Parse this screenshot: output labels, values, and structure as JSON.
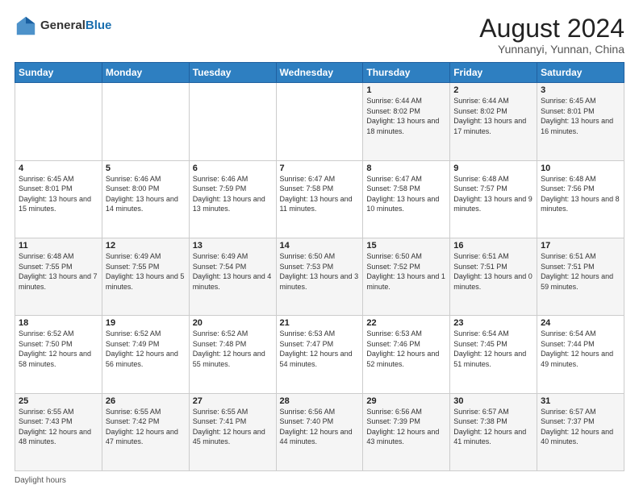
{
  "header": {
    "logo_general": "General",
    "logo_blue": "Blue",
    "main_title": "August 2024",
    "subtitle": "Yunnanyi, Yunnan, China"
  },
  "days_of_week": [
    "Sunday",
    "Monday",
    "Tuesday",
    "Wednesday",
    "Thursday",
    "Friday",
    "Saturday"
  ],
  "footer_text": "Daylight hours",
  "weeks": [
    [
      {
        "day": "",
        "info": ""
      },
      {
        "day": "",
        "info": ""
      },
      {
        "day": "",
        "info": ""
      },
      {
        "day": "",
        "info": ""
      },
      {
        "day": "1",
        "info": "Sunrise: 6:44 AM\nSunset: 8:02 PM\nDaylight: 13 hours\nand 18 minutes."
      },
      {
        "day": "2",
        "info": "Sunrise: 6:44 AM\nSunset: 8:02 PM\nDaylight: 13 hours\nand 17 minutes."
      },
      {
        "day": "3",
        "info": "Sunrise: 6:45 AM\nSunset: 8:01 PM\nDaylight: 13 hours\nand 16 minutes."
      }
    ],
    [
      {
        "day": "4",
        "info": "Sunrise: 6:45 AM\nSunset: 8:01 PM\nDaylight: 13 hours\nand 15 minutes."
      },
      {
        "day": "5",
        "info": "Sunrise: 6:46 AM\nSunset: 8:00 PM\nDaylight: 13 hours\nand 14 minutes."
      },
      {
        "day": "6",
        "info": "Sunrise: 6:46 AM\nSunset: 7:59 PM\nDaylight: 13 hours\nand 13 minutes."
      },
      {
        "day": "7",
        "info": "Sunrise: 6:47 AM\nSunset: 7:58 PM\nDaylight: 13 hours\nand 11 minutes."
      },
      {
        "day": "8",
        "info": "Sunrise: 6:47 AM\nSunset: 7:58 PM\nDaylight: 13 hours\nand 10 minutes."
      },
      {
        "day": "9",
        "info": "Sunrise: 6:48 AM\nSunset: 7:57 PM\nDaylight: 13 hours\nand 9 minutes."
      },
      {
        "day": "10",
        "info": "Sunrise: 6:48 AM\nSunset: 7:56 PM\nDaylight: 13 hours\nand 8 minutes."
      }
    ],
    [
      {
        "day": "11",
        "info": "Sunrise: 6:48 AM\nSunset: 7:55 PM\nDaylight: 13 hours\nand 7 minutes."
      },
      {
        "day": "12",
        "info": "Sunrise: 6:49 AM\nSunset: 7:55 PM\nDaylight: 13 hours\nand 5 minutes."
      },
      {
        "day": "13",
        "info": "Sunrise: 6:49 AM\nSunset: 7:54 PM\nDaylight: 13 hours\nand 4 minutes."
      },
      {
        "day": "14",
        "info": "Sunrise: 6:50 AM\nSunset: 7:53 PM\nDaylight: 13 hours\nand 3 minutes."
      },
      {
        "day": "15",
        "info": "Sunrise: 6:50 AM\nSunset: 7:52 PM\nDaylight: 13 hours\nand 1 minute."
      },
      {
        "day": "16",
        "info": "Sunrise: 6:51 AM\nSunset: 7:51 PM\nDaylight: 13 hours\nand 0 minutes."
      },
      {
        "day": "17",
        "info": "Sunrise: 6:51 AM\nSunset: 7:51 PM\nDaylight: 12 hours\nand 59 minutes."
      }
    ],
    [
      {
        "day": "18",
        "info": "Sunrise: 6:52 AM\nSunset: 7:50 PM\nDaylight: 12 hours\nand 58 minutes."
      },
      {
        "day": "19",
        "info": "Sunrise: 6:52 AM\nSunset: 7:49 PM\nDaylight: 12 hours\nand 56 minutes."
      },
      {
        "day": "20",
        "info": "Sunrise: 6:52 AM\nSunset: 7:48 PM\nDaylight: 12 hours\nand 55 minutes."
      },
      {
        "day": "21",
        "info": "Sunrise: 6:53 AM\nSunset: 7:47 PM\nDaylight: 12 hours\nand 54 minutes."
      },
      {
        "day": "22",
        "info": "Sunrise: 6:53 AM\nSunset: 7:46 PM\nDaylight: 12 hours\nand 52 minutes."
      },
      {
        "day": "23",
        "info": "Sunrise: 6:54 AM\nSunset: 7:45 PM\nDaylight: 12 hours\nand 51 minutes."
      },
      {
        "day": "24",
        "info": "Sunrise: 6:54 AM\nSunset: 7:44 PM\nDaylight: 12 hours\nand 49 minutes."
      }
    ],
    [
      {
        "day": "25",
        "info": "Sunrise: 6:55 AM\nSunset: 7:43 PM\nDaylight: 12 hours\nand 48 minutes."
      },
      {
        "day": "26",
        "info": "Sunrise: 6:55 AM\nSunset: 7:42 PM\nDaylight: 12 hours\nand 47 minutes."
      },
      {
        "day": "27",
        "info": "Sunrise: 6:55 AM\nSunset: 7:41 PM\nDaylight: 12 hours\nand 45 minutes."
      },
      {
        "day": "28",
        "info": "Sunrise: 6:56 AM\nSunset: 7:40 PM\nDaylight: 12 hours\nand 44 minutes."
      },
      {
        "day": "29",
        "info": "Sunrise: 6:56 AM\nSunset: 7:39 PM\nDaylight: 12 hours\nand 43 minutes."
      },
      {
        "day": "30",
        "info": "Sunrise: 6:57 AM\nSunset: 7:38 PM\nDaylight: 12 hours\nand 41 minutes."
      },
      {
        "day": "31",
        "info": "Sunrise: 6:57 AM\nSunset: 7:37 PM\nDaylight: 12 hours\nand 40 minutes."
      }
    ]
  ]
}
